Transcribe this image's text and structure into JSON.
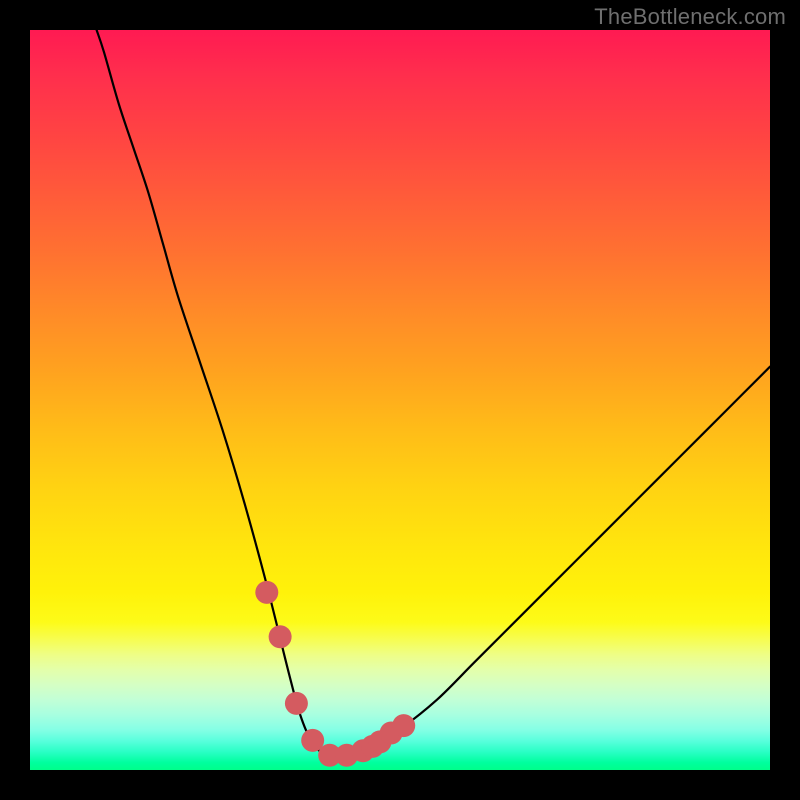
{
  "watermark": {
    "text": "TheBottleneck.com"
  },
  "colors": {
    "background": "#000000",
    "gradient_top": "#ff1a52",
    "gradient_bottom": "#00ff8a",
    "curve": "#000000",
    "markers": "#d45b60"
  },
  "chart_data": {
    "type": "line",
    "title": "",
    "xlabel": "",
    "ylabel": "",
    "xlim": [
      0,
      100
    ],
    "ylim": [
      0,
      100
    ],
    "grid": false,
    "legend": false,
    "note": "V-shaped bottleneck curve on rainbow gradient background. Values estimated from pixel positions; no axis ticks or numeric labels are visible.",
    "series": [
      {
        "name": "bottleneck-curve",
        "color": "#000000",
        "x": [
          9,
          10,
          12,
          14,
          16,
          18,
          20,
          23,
          26,
          29,
          32,
          35,
          36.5,
          38,
          40,
          43,
          46,
          50,
          55,
          60,
          65,
          70,
          76,
          82,
          88,
          94,
          100
        ],
        "y": [
          100,
          97,
          90,
          84,
          78,
          71,
          64,
          55,
          46,
          36,
          25,
          13,
          7.5,
          4,
          2,
          2,
          3,
          5.5,
          9.5,
          14.5,
          19.5,
          24.5,
          30.5,
          36.5,
          42.5,
          48.5,
          54.5
        ]
      },
      {
        "name": "valley-markers",
        "type": "scatter",
        "color": "#d45b60",
        "x": [
          32.0,
          33.8,
          36.0,
          38.2,
          40.5,
          42.8,
          45.0,
          46.3,
          47.3,
          48.8,
          50.5
        ],
        "y": [
          24.0,
          18.0,
          9.0,
          4.0,
          2.0,
          2.0,
          2.6,
          3.2,
          3.8,
          5.0,
          6.0
        ]
      }
    ]
  }
}
